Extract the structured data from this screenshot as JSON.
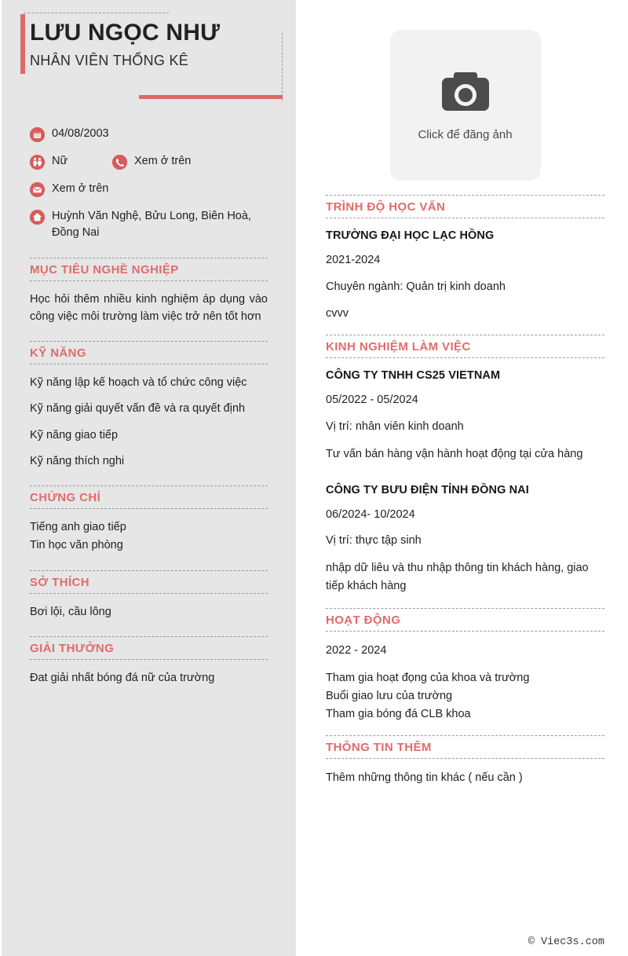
{
  "profile": {
    "name": "LƯU NGỌC NHƯ",
    "job_title": "NHÂN VIÊN THỐNG KÊ",
    "birthday": "04/08/2003",
    "gender": "Nữ",
    "phone": "Xem ở trên",
    "email": "Xem ở trên",
    "address": "Huỳnh Văn Nghệ, Bửu Long, Biên Hoà, Đồng Nai"
  },
  "photo": {
    "label": "Click để đăng ảnh",
    "icon": "camera-icon"
  },
  "sidebar_sections": [
    {
      "title": "MỤC TIÊU NGHỀ NGHIỆP",
      "items": [
        "Học hỏi thêm nhiều kinh nghiệm áp dụng vào công việc môi trường làm việc trở nên tốt hơn"
      ]
    },
    {
      "title": "KỸ NĂNG",
      "items": [
        "Kỹ năng lập kế hoạch và tổ chức công việc",
        "Kỹ năng giải quyết vấn đề và ra quyết định",
        "Kỹ năng giao tiếp",
        "Kỹ năng thích nghi"
      ]
    },
    {
      "title": "CHỨNG CHỈ",
      "items": [
        "Tiếng anh giao tiếp\nTin học văn phòng"
      ]
    },
    {
      "title": "SỞ THÍCH",
      "items": [
        "Bơi lội, cầu lông"
      ]
    },
    {
      "title": "GIẢI THƯỞNG",
      "items": [
        "Đat giải nhất bóng đá nữ của trường"
      ]
    }
  ],
  "education": {
    "title": "TRÌNH ĐỘ HỌC VẤN",
    "entries": [
      {
        "heading": "TRƯỜNG ĐẠI HỌC LẠC HỒNG",
        "lines": [
          "2021-2024",
          "Chuyên ngành: Quản trị kinh doanh",
          "cvvv"
        ]
      }
    ]
  },
  "experience": {
    "title": "KINH NGHIỆM LÀM VIỆC",
    "entries": [
      {
        "heading": "CÔNG TY TNHH CS25 VIETNAM",
        "lines": [
          "05/2022 - 05/2024",
          "Vị trí: nhân viên kinh doanh",
          "Tư vấn bán hàng vận hành hoạt động tại cửa hàng"
        ]
      },
      {
        "heading": "CÔNG TY BƯU ĐIỆN TỈNH ĐỒNG NAI",
        "lines": [
          "06/2024- 10/2024",
          "Vị trí: thực tập sinh",
          "nhập dữ liêu và thu nhập thông tin khách hàng, giao tiếp khách hàng"
        ]
      }
    ]
  },
  "activities": {
    "title": "HOẠT ĐỘNG",
    "entries": [
      {
        "heading": "",
        "lines": [
          "2022 - 2024",
          "Tham gia hoạt đọng của khoa và trường\nBuổi giao lưu của trường\nTham gia bóng đá CLB khoa"
        ]
      }
    ]
  },
  "additional": {
    "title": "THÔNG TIN THÊM",
    "entries": [
      {
        "heading": "",
        "lines": [
          "Thêm những thông tin khác ( nếu cần )"
        ]
      }
    ]
  },
  "footer": {
    "copyright": "© Viec3s.com"
  },
  "colors": {
    "accent": "#d96a68",
    "heading": "#e06b6b",
    "icon_bg": "#d65c5c",
    "sidebar_bg": "#e6e6e6",
    "photo_bg": "#f2f2f2",
    "text": "#1f1f1f"
  }
}
